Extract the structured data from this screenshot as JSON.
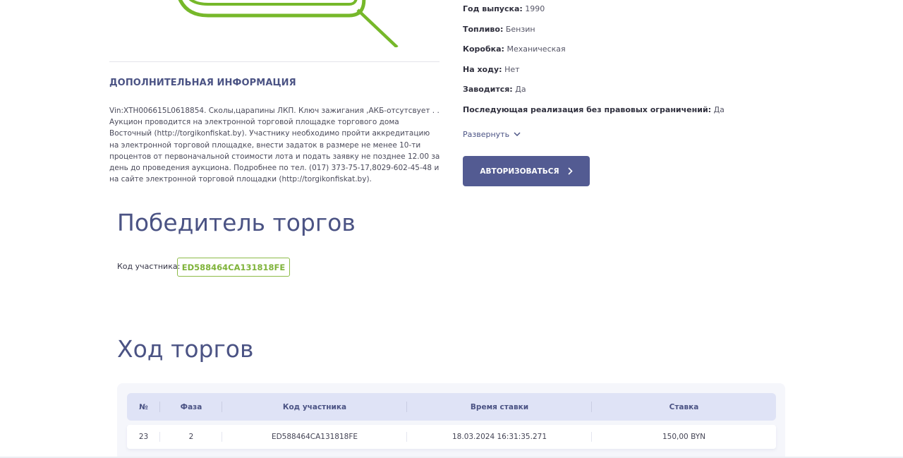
{
  "lot_image": {
    "icon": "placeholder-magnifier-image",
    "accent_color": "#76b82a"
  },
  "additional_info": {
    "title": "ДОПОЛНИТЕЛЬНАЯ ИНФОРМАЦИЯ",
    "text": "Vin:XTH006615L0618854. Сколы,царапины ЛКП. Ключ зажигания ,АКБ-отсутсвует . . Аукцион проводится на электронной торговой площадке торгового дома Восточный (http://torgikonfiskat.by). Участнику необходимо пройти аккредитацию на электронной торговой площадке, внести задаток в размере не менее 10-ти процентов от первоначальной стоимости лота и подать заявку не позднее 12.00 за день до проведения аукциона. Подробнее по тел. (017) 373-75-17,8029-602-45-48 и на сайте электронной торговой площадки (http://torgikonfiskat.by)."
  },
  "specs": [
    {
      "key": "Год выпуска:",
      "value": "1990"
    },
    {
      "key": "Топливо:",
      "value": "Бензин"
    },
    {
      "key": "Коробка:",
      "value": "Механическая"
    },
    {
      "key": "На ходу:",
      "value": "Нет"
    },
    {
      "key": "Заводится:",
      "value": "Да"
    },
    {
      "key": "Последующая реализация без правовых ограничений:",
      "value": "Да"
    }
  ],
  "expand": {
    "label": "Развернуть",
    "icon": "chevron-down-icon"
  },
  "auth_button": {
    "label": "АВТОРИЗОВАТЬСЯ",
    "icon": "chevron-right-icon",
    "color": "#535b92"
  },
  "winner": {
    "title": "Победитель торгов",
    "participant_label": "Код участника:",
    "participant_code": "ED588464CA131818FE",
    "accent_color": "#7fb33a"
  },
  "progress": {
    "title": "Ход торгов",
    "columns": [
      "№",
      "Фаза",
      "Код участника",
      "Время ставки",
      "Ставка"
    ],
    "rows": [
      [
        "23",
        "2",
        "ED588464CA131818FE",
        "18.03.2024 16:31:35.271",
        "150,00 BYN"
      ]
    ]
  }
}
